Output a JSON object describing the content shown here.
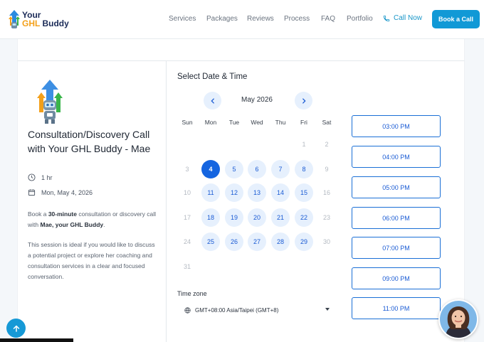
{
  "brand": {
    "line1": "Your",
    "line2_accent": "GHL",
    "line2_rest": " Buddy"
  },
  "nav": {
    "items": [
      "Services",
      "Packages",
      "Reviews",
      "Process",
      "FAQ",
      "Portfolio"
    ],
    "call_now": "Call Now",
    "book_call": "Book a Call"
  },
  "event": {
    "title": "Consultation/Discovery Call with Your GHL Buddy - Mae",
    "duration": "1 hr",
    "date": "Mon, May 4, 2026",
    "desc1_pre": "Book a ",
    "desc1_bold1": "30-minute",
    "desc1_mid": " consultation or discovery call with ",
    "desc1_bold2": "Mae, your GHL Buddy",
    "desc1_end": ".",
    "desc2": "This session is ideal if you would like to discuss a potential project or explore her coaching and consultation services in a clear and focused conversation."
  },
  "calendar": {
    "heading": "Select Date & Time",
    "month": "May 2026",
    "weekdays": [
      "Sun",
      "Mon",
      "Tue",
      "Wed",
      "Thu",
      "Fri",
      "Sat"
    ],
    "selected_day": "4",
    "days": [
      "1",
      "2",
      "3",
      "4",
      "5",
      "6",
      "7",
      "8",
      "9",
      "10",
      "11",
      "12",
      "13",
      "14",
      "15",
      "16",
      "17",
      "18",
      "19",
      "20",
      "21",
      "22",
      "23",
      "24",
      "25",
      "26",
      "27",
      "28",
      "29",
      "30",
      "31"
    ]
  },
  "timezone": {
    "label": "Time zone",
    "value": "GMT+08:00 Asia/Taipei (GMT+8)"
  },
  "slots": [
    "03:00 PM",
    "04:00 PM",
    "05:00 PM",
    "06:00 PM",
    "07:00 PM",
    "09:00 PM",
    "11:00 PM"
  ],
  "colors": {
    "accent": "#1565e0",
    "book_button": "#1199d6",
    "available_day_bg": "#e6f0fd"
  }
}
